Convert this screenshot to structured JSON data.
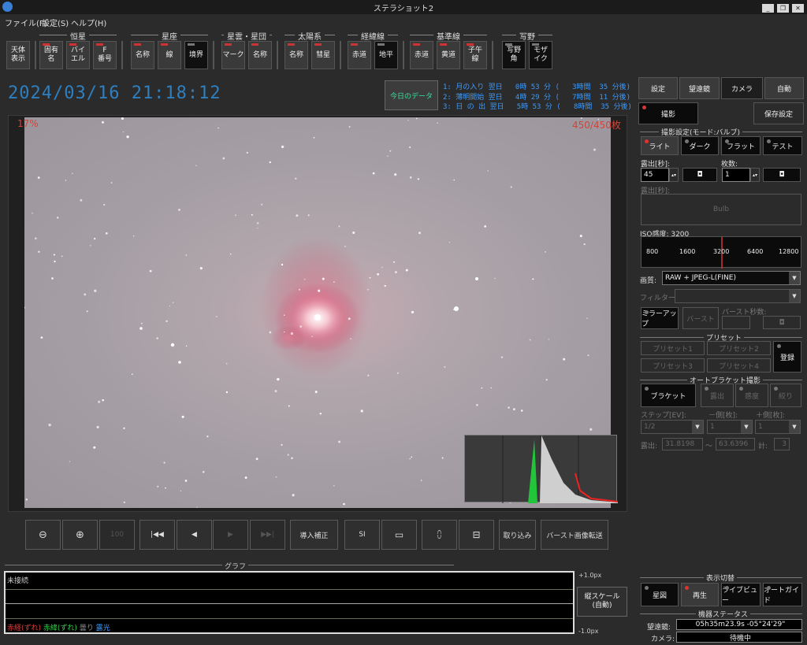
{
  "window": {
    "title": "ステラショット2"
  },
  "menu": [
    "ファイル(F)",
    "設定(S)",
    "ヘルプ(H)"
  ],
  "toolbar": {
    "zenith_label": "天体\n表示",
    "groups": [
      {
        "label": "恒星",
        "buttons": [
          "固有\n名",
          "バイ\nエル",
          "F\n番号"
        ]
      },
      {
        "label": "星座",
        "buttons": [
          "名称",
          "線",
          "境界"
        ]
      },
      {
        "label": "星雲・星団",
        "buttons": [
          "マーク",
          "名称"
        ]
      },
      {
        "label": "太陽系",
        "buttons": [
          "名称",
          "彗星"
        ]
      },
      {
        "label": "経緯線",
        "buttons": [
          "赤道",
          "地平"
        ]
      },
      {
        "label": "基準線",
        "buttons": [
          "赤道",
          "黄道",
          "子午\n線"
        ]
      },
      {
        "label": "写野",
        "buttons": [
          "写野\n角",
          "モザ\nイク"
        ]
      }
    ]
  },
  "datetime": "2024/03/16  21:18:12",
  "today_button": "今日のデータ",
  "events": [
    "1: 月の入り 翌日   0時 53 分 (   3時間  35 分後)",
    "2: 薄明開始 翌日   4時 29 分 (   7時間  11 分後)",
    "3: 日 の 出 翌日   5時 53 分 (   8時間  35 分後)"
  ],
  "image": {
    "percent": "17%",
    "count": "450/450枚"
  },
  "controls": {
    "zoom_out": "zoom-out",
    "zoom_in": "zoom-in",
    "fit": "100",
    "first": "|◀◀",
    "prev": "◀",
    "play": "▶",
    "last": "▶▶|",
    "guide_correct": "導入補正",
    "si": "SI",
    "folder": "folder",
    "import": "取り込み",
    "burst_transfer": "バースト画像転送"
  },
  "graph": {
    "title": "グラフ",
    "status": "未接続",
    "legend": [
      {
        "text": "赤経(ずれ)",
        "color": "#e23b3b"
      },
      {
        "text": "赤緯(ずれ)",
        "color": "#32d24a"
      },
      {
        "text": "曇り",
        "color": "#8a8a8a"
      },
      {
        "text": "露光",
        "color": "#3a9cff"
      }
    ],
    "scale_top": "+1.0px",
    "scale_bottom": "-1.0px",
    "vscale_button": "縦スケール\n(自動)"
  },
  "tabs": [
    "設定",
    "望遠鏡",
    "カメラ",
    "自動"
  ],
  "camera": {
    "shoot_button": "撮影",
    "save_settings_button": "保存設定",
    "shoot_settings_title": "撮影設定(モード:バルブ)",
    "modes": [
      "ライト",
      "ダーク",
      "フラット",
      "テスト"
    ],
    "exposure_label": "露出[秒]:",
    "exposure_value": "45",
    "frames_label": "枚数:",
    "frames_value": "1",
    "exposure2_label": "露出[秒]:",
    "bulb_label": "Bulb",
    "iso_label": "ISO感度: 3200",
    "iso_ticks": [
      "800",
      "1600",
      "3200",
      "6400",
      "12800"
    ],
    "quality_label": "画質:",
    "quality_value": "RAW + JPEG-L(FINE)",
    "filter_label": "フィルター:",
    "filter_value": "",
    "mirror_up_button": "ミラーアップ",
    "burst_button": "バースト",
    "burst_seconds_label": "バースト秒数:",
    "preset_title": "プリセット",
    "presets": [
      "プリセット1",
      "プリセット2",
      "プリセット3",
      "プリセット4"
    ],
    "register_button": "登録",
    "auto_bracket_title": "オートブラケット撮影",
    "bracket_buttons": [
      "ブラケット",
      "露出",
      "感度",
      "絞り"
    ],
    "step_label": "ステップ[EV]:",
    "minus_label": "－側[枚]:",
    "plus_label": "＋側[枚]:",
    "step_value": "1/2",
    "minus_value": "1",
    "plus_value": "1",
    "exposure_range_label": "露出:",
    "exposure_min": "31.8198",
    "range_sep": "～",
    "exposure_max": "63.6396",
    "total_label": "計:",
    "total_value": "3"
  },
  "display_switch": {
    "title": "表示切替",
    "buttons": [
      "星図",
      "再生",
      "ライブビュー",
      "オートガイド"
    ]
  },
  "device_status": {
    "title": "機器ステータス",
    "telescope_label": "望遠鏡:",
    "telescope_value": "05h35m23.9s  -05°24'29\"",
    "camera_label": "カメラ:",
    "camera_value": "待機中"
  }
}
